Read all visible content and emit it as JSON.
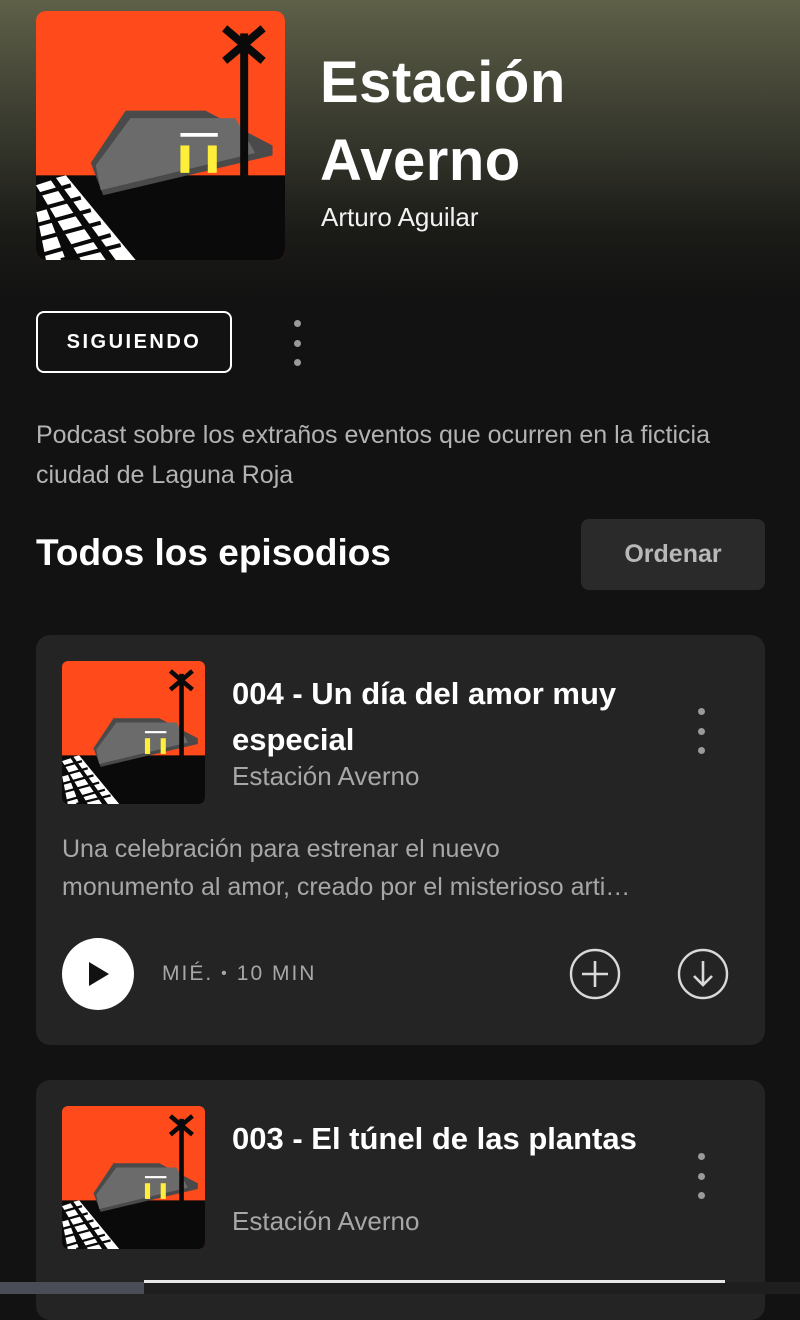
{
  "podcast": {
    "title_line1": "Estación",
    "title_line2": "Averno",
    "author": "Arturo Aguilar",
    "follow_label": "SIGUIENDO",
    "description": "Podcast sobre los extraños eventos que ocurren en la ficticia ciudad de Laguna Roja"
  },
  "episodes_section": {
    "title": "Todos los episodios",
    "sort_label": "Ordenar"
  },
  "episodes": [
    {
      "title": "004 - Un día del amor muy especial",
      "show": "Estación Averno",
      "description_line1": "Una celebración para estrenar el nuevo",
      "description_line2": "monumento al amor, creado por el misterioso arti…",
      "day": "MIÉ.",
      "duration": "10 MIN"
    },
    {
      "title": "003 - El túnel de las plantas",
      "show": "Estación Averno"
    }
  ],
  "icons": {
    "more": "more-vertical-icon",
    "play": "play-icon",
    "add": "add-circle-icon",
    "download": "download-icon"
  },
  "colors": {
    "background": "#121212",
    "card": "#242424",
    "artwork_orange": "#ff4b1c",
    "window_yellow": "#ffee3a",
    "secondary_text": "#a7a7a7"
  }
}
